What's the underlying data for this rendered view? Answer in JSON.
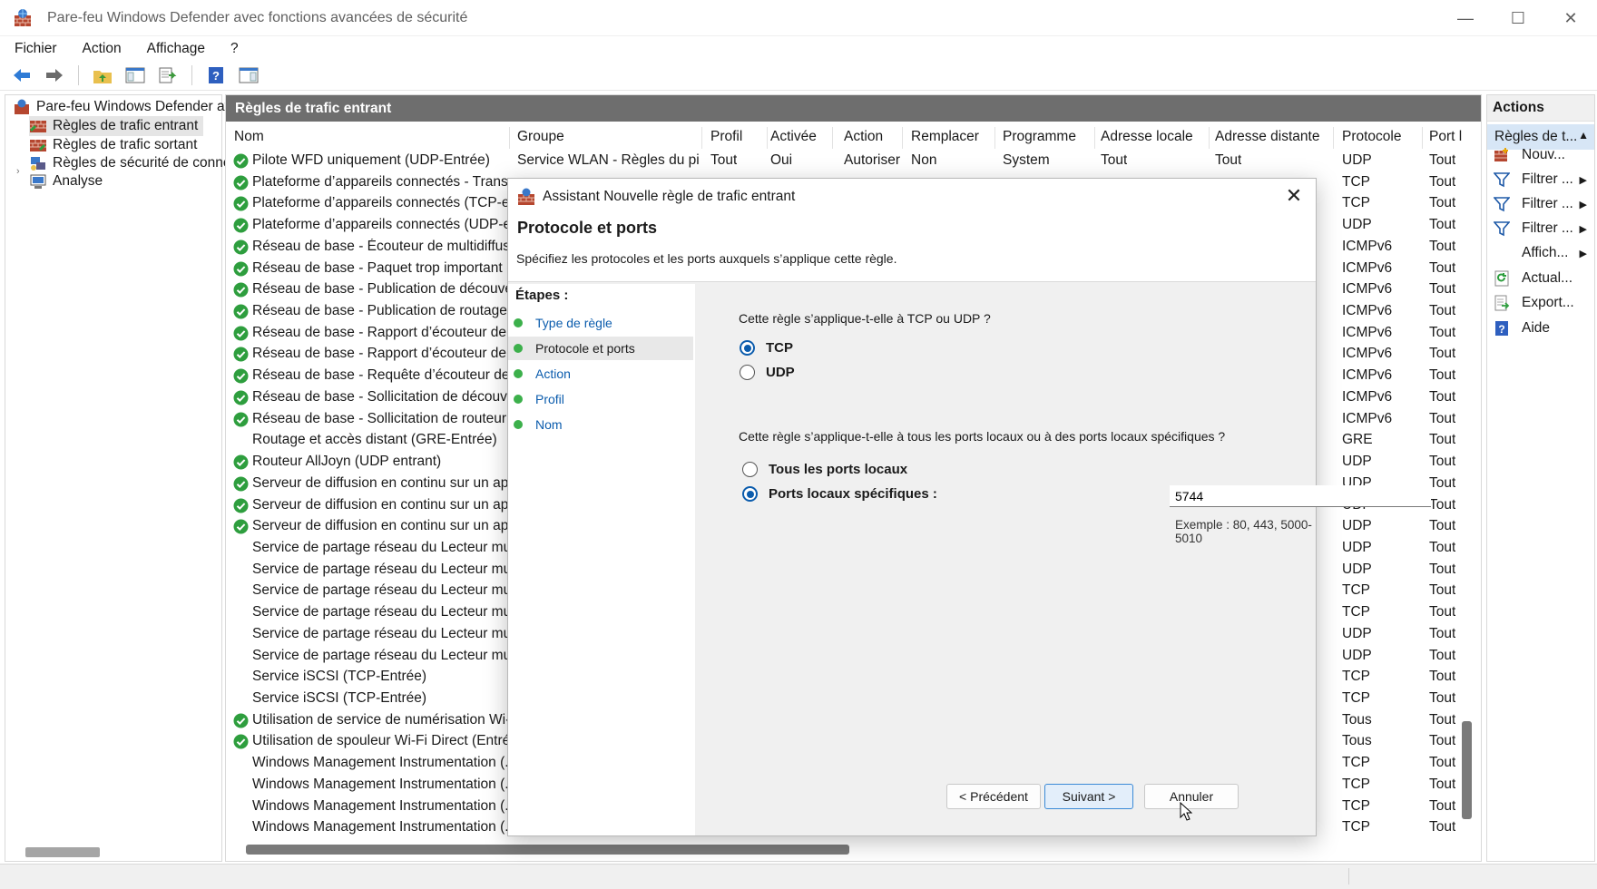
{
  "window": {
    "title": "Pare-feu Windows Defender avec fonctions avancées de sécurité",
    "controls": [
      "—",
      "☐",
      "✕"
    ]
  },
  "menu": [
    "Fichier",
    "Action",
    "Affichage",
    "?"
  ],
  "tree": {
    "root": "Pare-feu Windows Defender ave",
    "items": [
      "Règles de trafic entrant",
      "Règles de trafic sortant",
      "Règles de sécurité de conne",
      "Analyse"
    ]
  },
  "panel": {
    "title": "Règles de trafic entrant",
    "columns": [
      "Nom",
      "Groupe",
      "Profil",
      "Activée",
      "Action",
      "Remplacer",
      "Programme",
      "Adresse locale",
      "Adresse distante",
      "Protocole",
      "Port l"
    ],
    "first_row": {
      "name": "Pilote WFD uniquement (UDP-Entrée)",
      "group": "Service WLAN - Règles du pil...",
      "profile": "Tout",
      "enabled": "Oui",
      "action": "Autoriser",
      "override": "Non",
      "program": "System",
      "local": "Tout",
      "remote": "Tout",
      "protocol": "UDP",
      "port": "Tout"
    },
    "rows": [
      {
        "name": "Plateforme d’appareils connectés - Transp...",
        "protocol": "TCP",
        "port": "Tout",
        "enabled": true
      },
      {
        "name": "Plateforme d’appareils connectés (TCP-ent...",
        "protocol": "TCP",
        "port": "Tout",
        "enabled": true
      },
      {
        "name": "Plateforme d’appareils connectés (UDP-en...",
        "protocol": "UDP",
        "port": "Tout",
        "enabled": true
      },
      {
        "name": "Réseau de base - Écouteur de multidiffusi...",
        "protocol": "ICMPv6",
        "port": "Tout",
        "enabled": true
      },
      {
        "name": "Réseau de base - Paquet trop important (I...",
        "protocol": "ICMPv6",
        "port": "Tout",
        "enabled": true
      },
      {
        "name": "Réseau de base - Publication de découver...",
        "protocol": "ICMPv6",
        "port": "Tout",
        "enabled": true
      },
      {
        "name": "Réseau de base - Publication de routage (I...",
        "protocol": "ICMPv6",
        "port": "Tout",
        "enabled": true
      },
      {
        "name": "Réseau de base - Rapport d’écouteur de ...",
        "protocol": "ICMPv6",
        "port": "Tout",
        "enabled": true
      },
      {
        "name": "Réseau de base - Rapport d’écouteur de ...",
        "protocol": "ICMPv6",
        "port": "Tout",
        "enabled": true
      },
      {
        "name": "Réseau de base - Requête d’écouteur de ...",
        "protocol": "ICMPv6",
        "port": "Tout",
        "enabled": true
      },
      {
        "name": "Réseau de base - Sollicitation de découve...",
        "protocol": "ICMPv6",
        "port": "Tout",
        "enabled": true
      },
      {
        "name": "Réseau de base - Sollicitation de routeur (...",
        "protocol": "ICMPv6",
        "port": "Tout",
        "enabled": true
      },
      {
        "name": "Routage et accès distant (GRE-Entrée)",
        "protocol": "GRE",
        "port": "Tout",
        "enabled": false
      },
      {
        "name": "Routeur AllJoyn (UDP entrant)",
        "protocol": "UDP",
        "port": "Tout",
        "enabled": true
      },
      {
        "name": "Serveur de diffusion en continu sur un ap...",
        "protocol": "UDP",
        "port": "Tout",
        "enabled": true
      },
      {
        "name": "Serveur de diffusion en continu sur un ap...",
        "protocol": "UDP",
        "port": "Tout",
        "enabled": true
      },
      {
        "name": "Serveur de diffusion en continu sur un ap...",
        "protocol": "UDP",
        "port": "Tout",
        "enabled": true
      },
      {
        "name": "Service de partage réseau du Lecteur mult...",
        "protocol": "UDP",
        "port": "Tout",
        "enabled": false
      },
      {
        "name": "Service de partage réseau du Lecteur mult...",
        "protocol": "UDP",
        "port": "Tout",
        "enabled": false
      },
      {
        "name": "Service de partage réseau du Lecteur mult...",
        "protocol": "TCP",
        "port": "Tout",
        "enabled": false
      },
      {
        "name": "Service de partage réseau du Lecteur mult...",
        "protocol": "TCP",
        "port": "Tout",
        "enabled": false
      },
      {
        "name": "Service de partage réseau du Lecteur mult...",
        "protocol": "UDP",
        "port": "Tout",
        "enabled": false
      },
      {
        "name": "Service de partage réseau du Lecteur mult...",
        "protocol": "UDP",
        "port": "Tout",
        "enabled": false
      },
      {
        "name": "Service iSCSI (TCP-Entrée)",
        "protocol": "TCP",
        "port": "Tout",
        "enabled": false
      },
      {
        "name": "Service iSCSI (TCP-Entrée)",
        "protocol": "TCP",
        "port": "Tout",
        "enabled": false
      },
      {
        "name": "Utilisation de service de numérisation Wi-...",
        "protocol": "Tous",
        "port": "Tout",
        "enabled": true
      },
      {
        "name": "Utilisation de spouleur Wi-Fi Direct (Entrée)",
        "protocol": "Tous",
        "port": "Tout",
        "enabled": true
      },
      {
        "name": "Windows Management Instrumentation (...",
        "protocol": "TCP",
        "port": "Tout",
        "enabled": false
      },
      {
        "name": "Windows Management Instrumentation (...",
        "protocol": "TCP",
        "port": "Tout",
        "enabled": false
      },
      {
        "name": "Windows Management Instrumentation (...",
        "protocol": "TCP",
        "port": "Tout",
        "enabled": false
      },
      {
        "name": "Windows Management Instrumentation (...",
        "protocol": "TCP",
        "port": "Tout",
        "enabled": false
      }
    ]
  },
  "actions": {
    "title": "Actions",
    "section": "Règles de t...",
    "items": [
      {
        "label": "Nouv...",
        "icon": "new-rule-icon",
        "submenu": false
      },
      {
        "label": "Filtrer ...",
        "icon": "filter-icon",
        "submenu": true
      },
      {
        "label": "Filtrer ...",
        "icon": "filter-icon",
        "submenu": true
      },
      {
        "label": "Filtrer ...",
        "icon": "filter-icon",
        "submenu": true
      },
      {
        "label": "Affich...",
        "icon": "",
        "submenu": true
      },
      {
        "label": "Actual...",
        "icon": "refresh-icon",
        "submenu": false
      },
      {
        "label": "Export...",
        "icon": "export-icon",
        "submenu": false
      },
      {
        "label": "Aide",
        "icon": "help-icon",
        "submenu": false
      }
    ]
  },
  "dialog": {
    "title": "Assistant Nouvelle règle de trafic entrant",
    "heading": "Protocole et ports",
    "description": "Spécifiez les protocoles et les ports auxquels s’applique cette règle.",
    "steps_title": "Étapes :",
    "steps": [
      "Type de règle",
      "Protocole et ports",
      "Action",
      "Profil",
      "Nom"
    ],
    "current_step": "Protocole et ports",
    "q1": "Cette règle s’applique-t-elle à TCP ou UDP ?",
    "opt_tcp": "TCP",
    "opt_udp": "UDP",
    "protocol_selected": "TCP",
    "q2": "Cette règle s’applique-t-elle à tous les ports locaux ou à des ports locaux spécifiques ?",
    "opt_all_ports": "Tous les ports locaux",
    "opt_specific_ports": "Ports locaux spécifiques :",
    "ports_selected": "specific",
    "port_value": "5744",
    "example": "Exemple : 80, 443, 5000-5010",
    "btn_back": "< Précédent",
    "btn_next": "Suivant >",
    "btn_cancel": "Annuler"
  },
  "colors": {
    "accent": "#0b5cad",
    "panel_header": "#6e6e6e",
    "enabled_check": "#2e9e3e",
    "actions_selected": "#d7e6f6"
  }
}
